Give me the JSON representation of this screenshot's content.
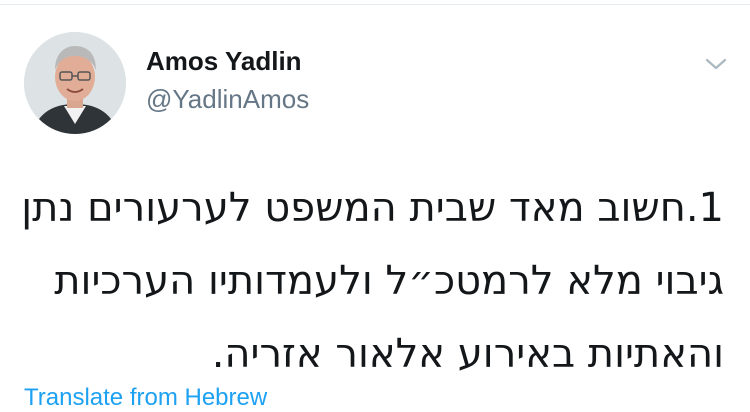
{
  "user": {
    "display_name": "Amos Yadlin",
    "handle": "@YadlinAmos",
    "avatar_icon": "profile-photo"
  },
  "tweet": {
    "lines": [
      "1.חשוב מאד שבית המשפט לערעורים נתן",
      "גיבוי מלא לרמטכ״ל ולעמדותיו הערכיות",
      "והאתיות באירוע אלאור אזריה."
    ]
  },
  "translate_link": "Translate from Hebrew",
  "menu_icon": "chevron-down-icon",
  "colors": {
    "text_primary": "#14171a",
    "text_secondary": "#657786",
    "link": "#1da1f2",
    "divider": "#e6ecf0",
    "chevron": "#aab8c2"
  }
}
